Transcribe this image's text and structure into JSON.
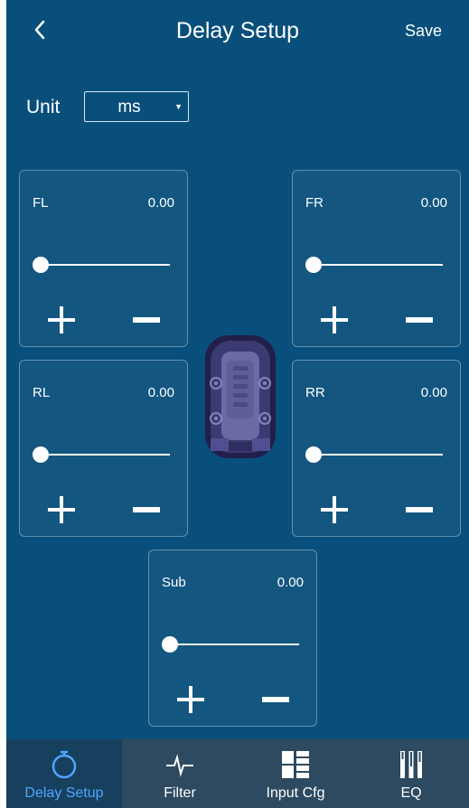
{
  "header": {
    "title": "Delay Setup",
    "save_label": "Save"
  },
  "unit": {
    "label": "Unit",
    "value": "ms"
  },
  "channels": {
    "fl": {
      "name": "FL",
      "value": "0.00",
      "slider_fraction": 0
    },
    "fr": {
      "name": "FR",
      "value": "0.00",
      "slider_fraction": 0
    },
    "rl": {
      "name": "RL",
      "value": "0.00",
      "slider_fraction": 0
    },
    "rr": {
      "name": "RR",
      "value": "0.00",
      "slider_fraction": 0
    },
    "sub": {
      "name": "Sub",
      "value": "0.00",
      "slider_fraction": 0
    }
  },
  "nav": {
    "items": [
      {
        "label": "Delay Setup",
        "icon": "stopwatch-icon",
        "active": true
      },
      {
        "label": "Filter",
        "icon": "waveform-icon",
        "active": false
      },
      {
        "label": "Input Cfg",
        "icon": "grid-icon",
        "active": false
      },
      {
        "label": "EQ",
        "icon": "equalizer-icon",
        "active": false
      }
    ]
  },
  "colors": {
    "background": "#094f7b",
    "nav_background": "#2d4a60",
    "nav_active_background": "#17405f",
    "nav_active_label": "#4fa6ff",
    "panel_border": "#5f91ad"
  }
}
